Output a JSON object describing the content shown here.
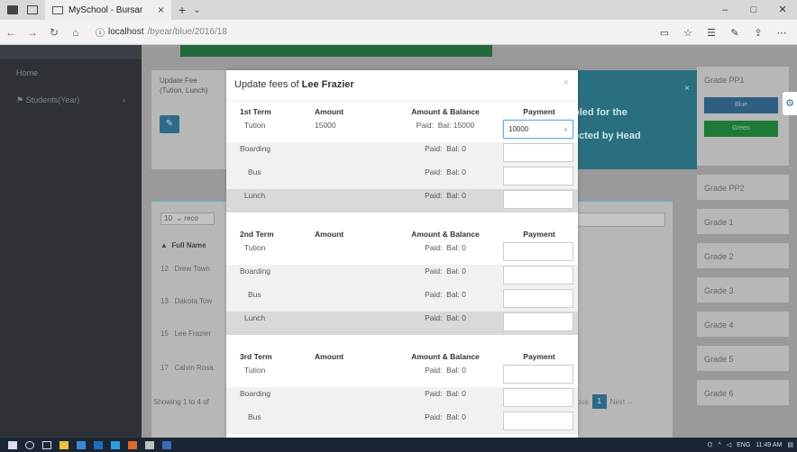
{
  "browser": {
    "tab_title": "MySchool - Bursar",
    "url_host": "localhost",
    "url_path": "/byear/blue/2016/18",
    "window_controls": [
      "–",
      "□",
      "✕"
    ]
  },
  "sidebar": {
    "items": [
      "Home",
      "Students(Year)"
    ],
    "students_chevron": "‹"
  },
  "background": {
    "card_title": "Update Fee (Tution, Lunch)",
    "edit_icon": "✎",
    "teal_text_1": "bled for the",
    "teal_text_2": "ected by Head",
    "length_select": "10",
    "length_suffix": "reco",
    "table_header": "Full Name",
    "rows": [
      {
        "num": "12",
        "name": "Drew Town"
      },
      {
        "num": "13",
        "name": "Dakota Tow"
      },
      {
        "num": "15",
        "name": "Lee Frazier"
      },
      {
        "num": "17",
        "name": "Calvin Rosa"
      }
    ],
    "showing": "Showing 1 to 4 of",
    "pager_prev": "vious",
    "pager_current": "1",
    "pager_next": "Next →"
  },
  "grades": {
    "first": "Grade PP1",
    "blue_btn": "Blue",
    "green_btn": "Green",
    "list": [
      "Grade PP2",
      "Grade 1",
      "Grade 2",
      "Grade 3",
      "Grade 4",
      "Grade 5",
      "Grade 6"
    ]
  },
  "modal": {
    "title_prefix": "Update fees of",
    "student_name": "Lee Frazier",
    "close": "×",
    "col_amount": "Amount",
    "col_balance": "Amount & Balance",
    "col_payment": "Payment",
    "terms": [
      {
        "name": "1st Term",
        "rows": [
          {
            "item": "Tution",
            "amount": "15000",
            "paid": "Paid:",
            "bal": "Bal: 15000",
            "payment": "10000"
          },
          {
            "item": "Boarding",
            "amount": "",
            "paid": "Paid:",
            "bal": "Bal: 0",
            "payment": ""
          },
          {
            "item": "Bus",
            "amount": "",
            "paid": "Paid:",
            "bal": "Bal: 0",
            "payment": ""
          },
          {
            "item": "Lunch",
            "amount": "",
            "paid": "Paid:",
            "bal": "Bal: 0",
            "payment": ""
          }
        ]
      },
      {
        "name": "2nd Term",
        "rows": [
          {
            "item": "Tution",
            "amount": "",
            "paid": "Paid:",
            "bal": "Bal: 0",
            "payment": ""
          },
          {
            "item": "Boarding",
            "amount": "",
            "paid": "Paid:",
            "bal": "Bal: 0",
            "payment": ""
          },
          {
            "item": "Bus",
            "amount": "",
            "paid": "Paid:",
            "bal": "Bal: 0",
            "payment": ""
          },
          {
            "item": "Lunch",
            "amount": "",
            "paid": "Paid:",
            "bal": "Bal: 0",
            "payment": ""
          }
        ]
      },
      {
        "name": "3rd Term",
        "rows": [
          {
            "item": "Tution",
            "amount": "",
            "paid": "Paid:",
            "bal": "Bal: 0",
            "payment": ""
          },
          {
            "item": "Boarding",
            "amount": "",
            "paid": "Paid:",
            "bal": "Bal: 0",
            "payment": ""
          },
          {
            "item": "Bus",
            "amount": "",
            "paid": "Paid:",
            "bal": "Bal: 0",
            "payment": ""
          }
        ]
      }
    ]
  },
  "taskbar": {
    "lang": "ENG",
    "time": "11:49 AM"
  },
  "colors": {
    "sidebar": "#2e3237",
    "teal": "#2a6f80",
    "primary": "#2f6b88",
    "green": "#1f7a3a"
  }
}
